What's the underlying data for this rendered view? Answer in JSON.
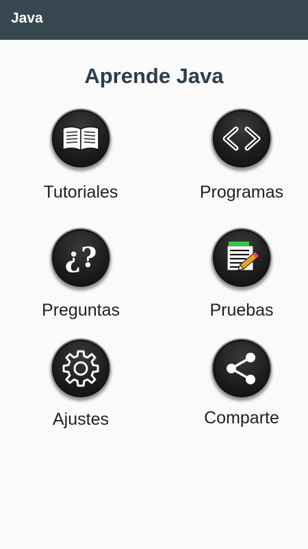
{
  "appbar": {
    "title": "Java"
  },
  "page_title": "Aprende Java",
  "tiles": [
    {
      "label": "Tutoriales",
      "icon": "open-book-icon"
    },
    {
      "label": "Programas",
      "icon": "code-brackets-icon"
    },
    {
      "label": "Preguntas",
      "icon": "question-marks-icon",
      "glyph": "¿?"
    },
    {
      "label": "Pruebas",
      "icon": "notepad-pencil-icon"
    },
    {
      "label": "Ajustes",
      "icon": "gear-icon"
    },
    {
      "label": "Comparte",
      "icon": "share-icon"
    }
  ]
}
